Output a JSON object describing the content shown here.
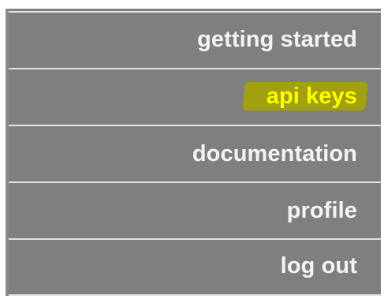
{
  "nav_menu": {
    "items": [
      {
        "label": "getting started",
        "active": false
      },
      {
        "label": "api keys",
        "active": true
      },
      {
        "label": "documentation",
        "active": false
      },
      {
        "label": "profile",
        "active": false
      },
      {
        "label": "log out",
        "active": false
      }
    ]
  },
  "colors": {
    "menu_background": "#7f7f7f",
    "menu_text": "#f4f4f4",
    "divider": "#e2e2e2",
    "highlight_text": "#ffff00",
    "highlight_marker": "#a0a010"
  }
}
